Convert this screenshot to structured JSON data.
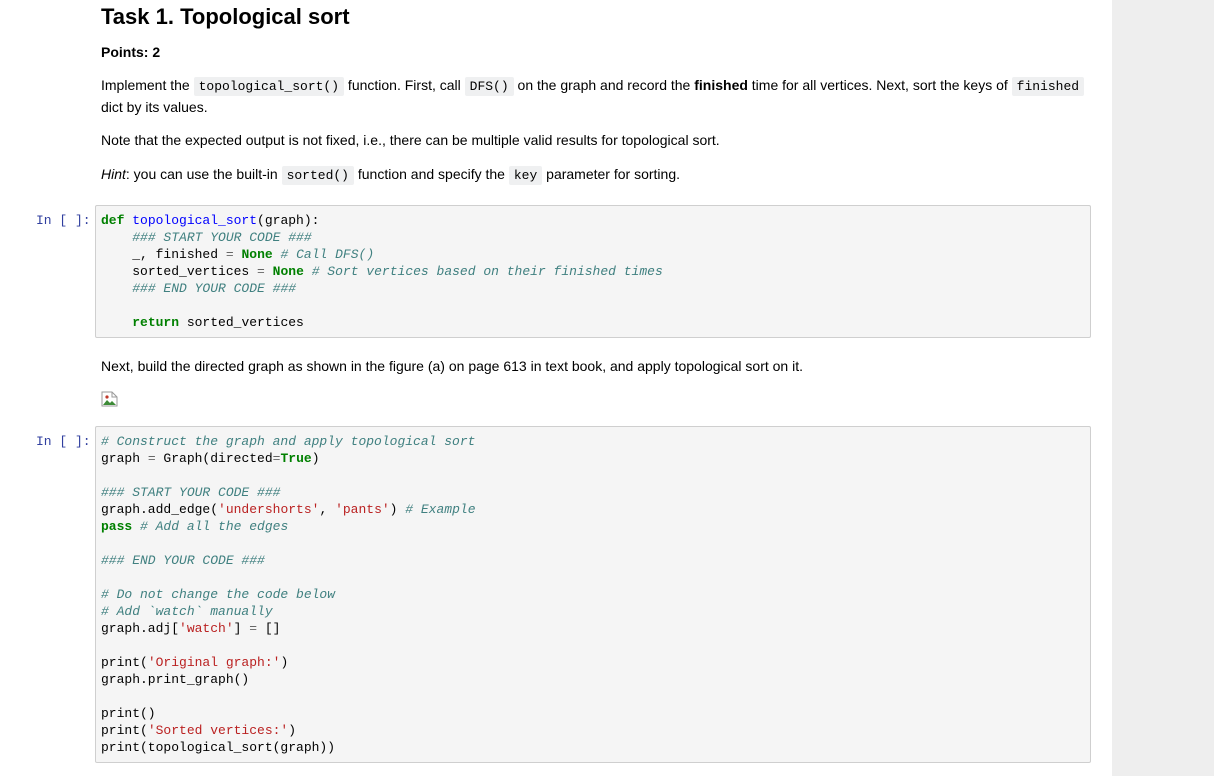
{
  "task": {
    "title": "Task 1. Topological sort",
    "points": "Points: 2",
    "p1": {
      "a": "Implement the ",
      "c1": "topological_sort()",
      "b": " function. First, call ",
      "c2": "DFS()",
      "c": " on the graph and record the ",
      "bold": "finished",
      "d": " time for all vertices. Next, sort the keys of ",
      "c3": "finished",
      "e": "dict by its values."
    },
    "p2": "Note that the expected output is not fixed, i.e., there can be multiple valid results for topological sort.",
    "p3": {
      "hint": "Hint",
      "a": ": you can use the built-in ",
      "c1": "sorted()",
      "b": " function and specify the ",
      "c2": "key",
      "c": " parameter for sorting."
    },
    "p4": "Next, build the directed graph as shown in the figure (a) on page 613 in text book, and apply topological sort on it."
  },
  "cells": [
    {
      "prompt": "In [ ]:",
      "lines": {
        "l1_kw": "def",
        "l1_fn": "topological_sort",
        "l1_rest": "(graph):",
        "l2": "### START YOUR CODE ###",
        "l3_a": "_, finished ",
        "l3_op": "=",
        "l3_kw": "None",
        "l3_cm": "# Call DFS()",
        "l4_a": "sorted_vertices ",
        "l4_op": "=",
        "l4_kw": "None",
        "l4_cm": "# Sort vertices based on their finished times",
        "l5": "### END YOUR CODE ###",
        "l6_kw": "return",
        "l6_rest": " sorted_vertices"
      }
    },
    {
      "prompt": "In [ ]:",
      "lines": {
        "l1": "# Construct the graph and apply topological sort",
        "l2_a": "graph ",
        "l2_op": "=",
        "l2_b": " Graph(directed",
        "l2_op2": "=",
        "l2_kw": "True",
        "l2_c": ")",
        "l3": "### START YOUR CODE ###",
        "l4_a": "graph.add_edge(",
        "l4_s1": "'undershorts'",
        "l4_b": ", ",
        "l4_s2": "'pants'",
        "l4_c": ") ",
        "l4_cm": "# Example",
        "l5_kw": "pass",
        "l5_cm": " # Add all the edges",
        "l6": "### END YOUR CODE ###",
        "l7": "# Do not change the code below",
        "l8": "# Add `watch` manually",
        "l9_a": "graph.adj[",
        "l9_s": "'watch'",
        "l9_b": "] ",
        "l9_op": "=",
        "l9_c": " []",
        "l10_a": "print(",
        "l10_s": "'Original graph:'",
        "l10_b": ")",
        "l11": "graph.print_graph()",
        "l12": "print()",
        "l13_a": "print(",
        "l13_s": "'Sorted vertices:'",
        "l13_b": ")",
        "l14": "print(topological_sort(graph))"
      }
    }
  ]
}
